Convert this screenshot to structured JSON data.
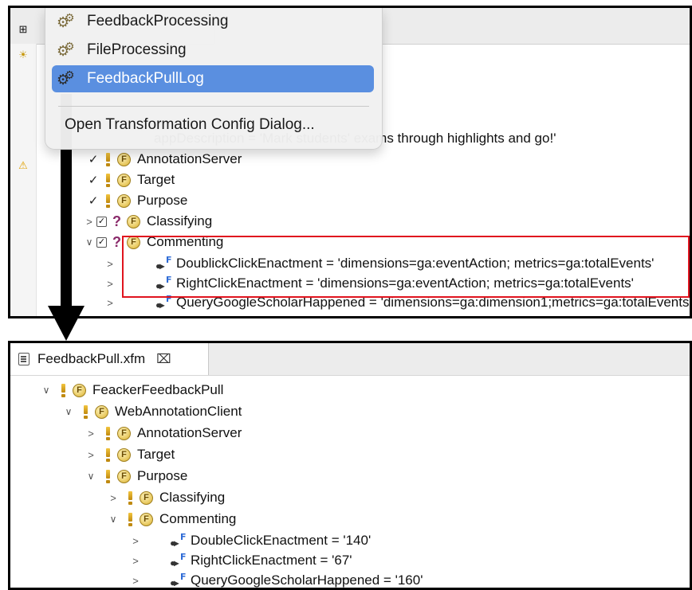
{
  "top_panel": {
    "menu": {
      "items": [
        {
          "label": "FeedbackProcessing",
          "icon": "gears-icon",
          "selected": false
        },
        {
          "label": "FileProcessing",
          "icon": "gears-icon",
          "selected": false
        },
        {
          "label": "FeedbackPullLog",
          "icon": "gears-icon",
          "selected": true
        }
      ],
      "dialog_label": "Open Transformation Config Dialog..."
    },
    "tree": {
      "partial_row": "appDescription = 'Mark students' exams through highlights and go!'",
      "rows": [
        {
          "label": "AnnotationServer"
        },
        {
          "label": "Target"
        },
        {
          "label": "Purpose"
        },
        {
          "label": "Classifying"
        },
        {
          "label": "Commenting"
        },
        {
          "label": "DoublickClickEnactment = 'dimensions=ga:eventAction; metrics=ga:totalEvents'"
        },
        {
          "label": "RightClickEnactment = 'dimensions=ga:eventAction; metrics=ga:totalEvents'"
        },
        {
          "label": "QueryGoogleScholarHappened = 'dimensions=ga:dimension1;metrics=ga:totalEvents'"
        }
      ]
    }
  },
  "bottom_panel": {
    "tab": {
      "label": "FeedbackPull.xfm",
      "close": "⌧"
    },
    "tree": [
      {
        "label": "FeackerFeedbackPull"
      },
      {
        "label": "WebAnnotationClient"
      },
      {
        "label": "AnnotationServer"
      },
      {
        "label": "Target"
      },
      {
        "label": "Purpose"
      },
      {
        "label": "Classifying"
      },
      {
        "label": "Commenting"
      },
      {
        "label": "DoubleClickEnactment = '140'"
      },
      {
        "label": "RightClickEnactment = '67'"
      },
      {
        "label": "QueryGoogleScholarHappened = '160'"
      }
    ]
  },
  "colors": {
    "menu_selection": "#5a8fe0",
    "highlight_box": "#e0141e",
    "feature_icon": "#e7c65a"
  }
}
